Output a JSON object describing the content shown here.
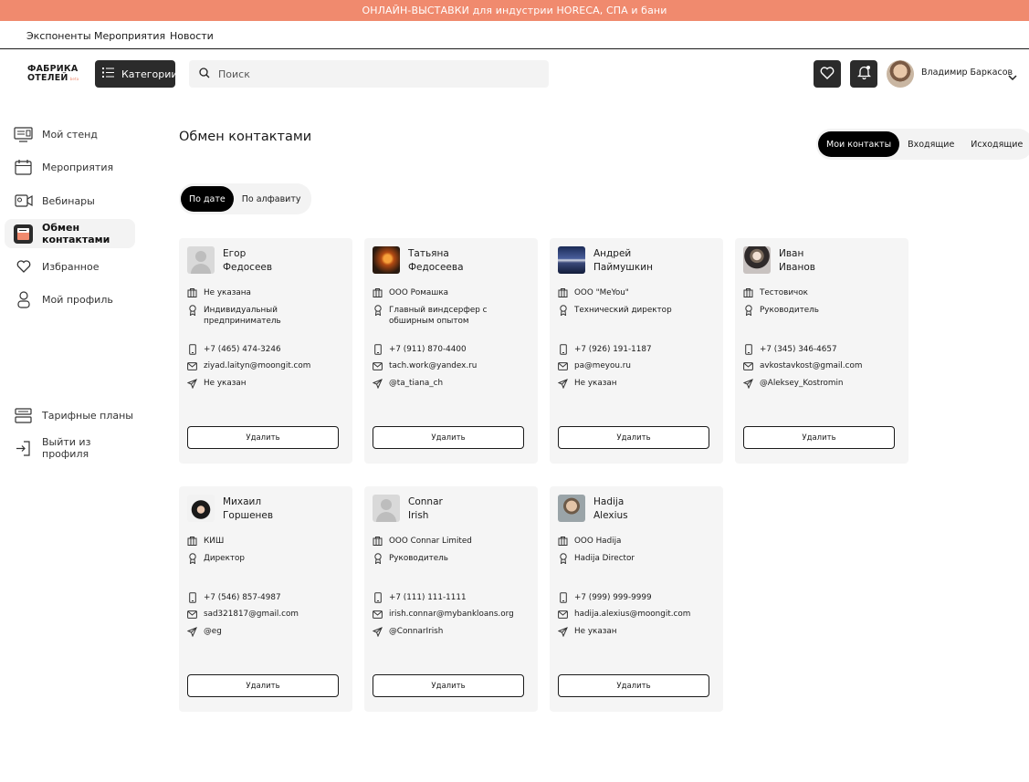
{
  "banner": "ОНЛАЙН-ВЫСТАВКИ для индустрии HORECA, СПА и бани",
  "topnav": [
    "Экспоненты",
    "Мероприятия",
    "Новости"
  ],
  "header": {
    "logo_line1": "ФАБРИКА",
    "logo_line2": "ОТЕЛЕЙ",
    "logo_beta": "beta",
    "categories_label": "Категории",
    "search_placeholder": "Поиск",
    "user_name": "Владимир Баркасов"
  },
  "sidebar": {
    "items": [
      {
        "label": "Мой стенд",
        "icon": "stand-icon"
      },
      {
        "label": "Мероприятия",
        "icon": "calendar-icon"
      },
      {
        "label": "Вебинары",
        "icon": "video-icon"
      },
      {
        "label": "Обмен контактами",
        "icon": "contacts-icon",
        "active": true
      },
      {
        "label": "Избранное",
        "icon": "heart-icon"
      },
      {
        "label": "Мой профиль",
        "icon": "profile-icon"
      }
    ],
    "bottom": [
      {
        "label": "Тарифные планы",
        "icon": "plans-icon"
      },
      {
        "label": "Выйти из профиля",
        "icon": "logout-icon"
      }
    ]
  },
  "main": {
    "title": "Обмен контактами",
    "tabs": [
      "Мои контакты",
      "Входящие",
      "Исходящие"
    ],
    "active_tab": 0,
    "sort": [
      "По дате",
      "По алфавиту"
    ],
    "active_sort": 0,
    "delete_label": "Удалить"
  },
  "contacts": [
    {
      "first": "Егор",
      "last": "Федосеев",
      "company": "Не указана",
      "position": "Индивидуальный предприниматель",
      "phone": "+7 (465) 474-3246",
      "email": "ziyad.laityn@moongit.com",
      "telegram": "Не указан",
      "avatar": "placeholder"
    },
    {
      "first": "Татьяна",
      "last": "Федосеева",
      "company": "ООО Ромашка",
      "position": "Главный виндсерфер с обширным опытом",
      "phone": "+7 (911) 870-4400",
      "email": "tach.work@yandex.ru",
      "telegram": "@ta_tiana_ch",
      "avatar": "photo-fire"
    },
    {
      "first": "Андрей",
      "last": "Паймушкин",
      "company": "ООО \"MeYou\"",
      "position": "Технический директор",
      "phone": "+7 (926) 191-1187",
      "email": "pa@meyou.ru",
      "telegram": "Не указан",
      "avatar": "photo-blue"
    },
    {
      "first": "Иван",
      "last": "Иванов",
      "company": "Тестовичок",
      "position": "Руководитель",
      "phone": "+7 (345) 346-4657",
      "email": "avkostavkost@gmail.com",
      "telegram": "@Aleksey_Kostromin",
      "avatar": "photo-robe"
    },
    {
      "first": "Михаил",
      "last": "Горшенев",
      "company": "КИШ",
      "position": "Директор",
      "phone": "+7 (546) 857-4987",
      "email": "sad321817@gmail.com",
      "telegram": "@eg",
      "avatar": "photo-punk"
    },
    {
      "first": "Connar",
      "last": "Irish",
      "company": "ООО Connar Limited",
      "position": "Руководитель",
      "phone": "+7 (111) 111-1111",
      "email": "irish.connar@mybankloans.org",
      "telegram": "@ConnarIrish",
      "avatar": "placeholder"
    },
    {
      "first": "Hadija",
      "last": "Alexius",
      "company": "ООО Hadija",
      "position": "Hadija Director",
      "phone": "+7 (999) 999-9999",
      "email": "hadija.alexius@moongit.com",
      "telegram": "Не указан",
      "avatar": "photo-man"
    }
  ],
  "colors": {
    "accent": "#f08a6e",
    "dark": "#2b2b2b",
    "card": "#f5f5f5"
  }
}
